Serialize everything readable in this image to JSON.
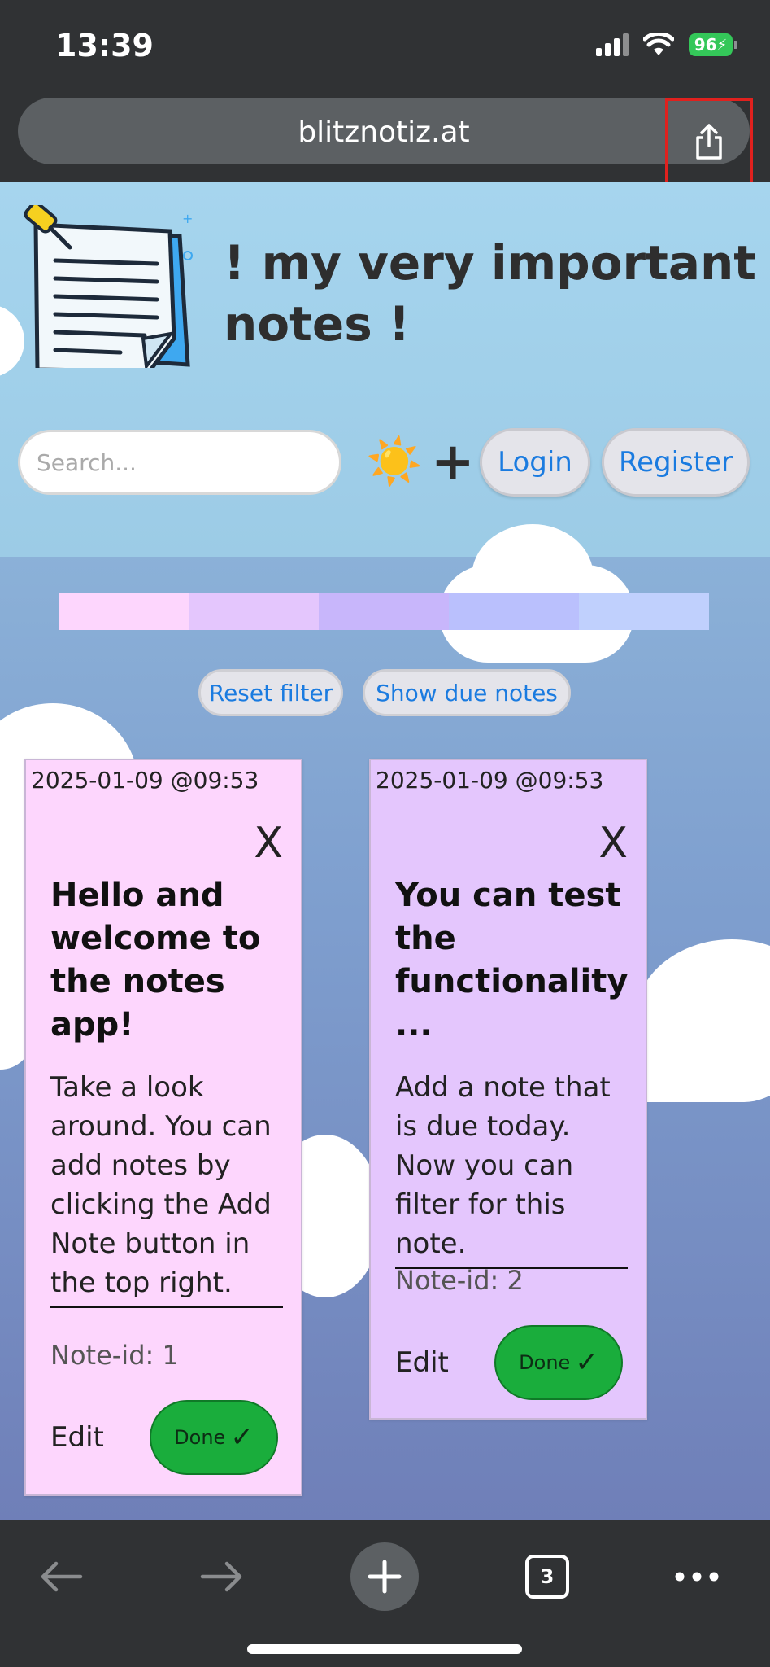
{
  "status_bar": {
    "time": "13:39",
    "battery": "96",
    "icons": [
      "signal-icon",
      "wifi-icon",
      "battery-charging-icon"
    ]
  },
  "browser": {
    "url": "blitznotiz.at",
    "share_icon": "share-icon",
    "highlight_color": "#e0211e"
  },
  "page": {
    "title": "! my very important notes !",
    "search": {
      "placeholder": "Search...",
      "value": ""
    },
    "theme_icon": "☀️",
    "add_icon": "+",
    "login_label": "Login",
    "register_label": "Register",
    "color_filters": [
      "#fdd6fd",
      "#e4c6fd",
      "#c8b6fb",
      "#bac0fd",
      "#c0d0fd"
    ],
    "reset_filter_label": "Reset filter",
    "show_due_label": "Show due notes"
  },
  "notes": [
    {
      "date": "2025-01-09 @09:53",
      "close": "X",
      "title": "Hello and welcome to the notes app!",
      "body": "Take a look around. You can add notes by clicking the Add Note button in the top right.",
      "id_label": "Note-id: 1",
      "edit_label": "Edit",
      "done_label": "Done",
      "done_icon": "✓",
      "color": "#fdd6fd"
    },
    {
      "date": "2025-01-09 @09:53",
      "close": "X",
      "title": "You can test the functionality ...",
      "body": "Add a note that is due today. Now you can filter for this note.",
      "id_label": "Note-id: 2",
      "edit_label": "Edit",
      "done_label": "Done",
      "done_icon": "✓",
      "color": "#e4c6fd"
    }
  ],
  "toolbar": {
    "tab_count": "3",
    "icons": [
      "back-arrow-icon",
      "forward-arrow-icon",
      "new-tab-plus-icon",
      "tabs-icon",
      "more-dots-icon"
    ]
  }
}
